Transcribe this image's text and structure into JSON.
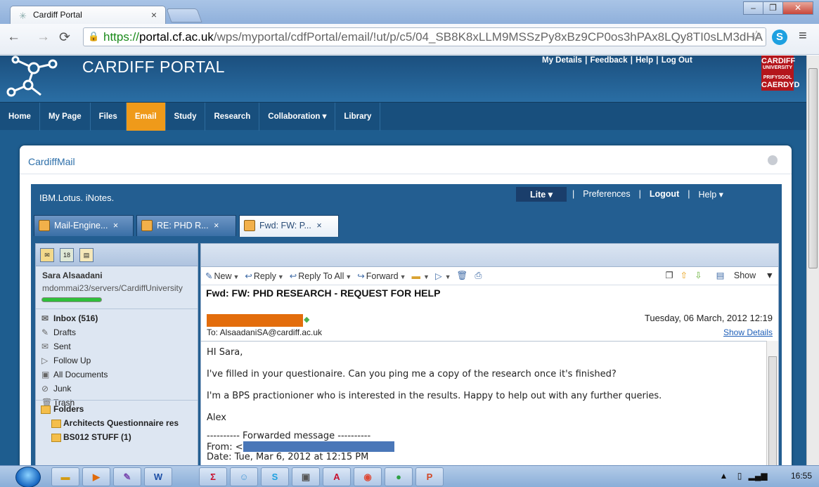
{
  "browser": {
    "tab_title": "Cardiff Portal",
    "tab_close": "×",
    "url_https": "https://",
    "url_domain": "portal.cf.ac.uk",
    "url_path": "/wps/myportal/cdfPortal/email/!ut/p/c5/04_SB8K8xLLM9MSSzPy8xBz9CP0os3hPAx8LQy8TI0sLM3dHA"
  },
  "portal": {
    "brand": "CARDIFF PORTAL",
    "top_links": [
      "My Details",
      "Feedback",
      "Help",
      "Log Out"
    ],
    "logo_lines": [
      "CARDIFF",
      "UNIVERSITY",
      "PRIFYSGOL",
      "CAERDYD"
    ],
    "nav": [
      {
        "label": "Home"
      },
      {
        "label": "My Page"
      },
      {
        "label": "Files"
      },
      {
        "label": "Email",
        "active": true
      },
      {
        "label": "Study"
      },
      {
        "label": "Research"
      },
      {
        "label": "Collaboration ▾"
      },
      {
        "label": "Library"
      }
    ],
    "card_title": "CardiffMail"
  },
  "inotes": {
    "product": "IBM.Lotus. iNotes.",
    "menu": {
      "lite": "Lite ▾",
      "preferences": "Preferences",
      "logout": "Logout",
      "help": "Help ▾"
    },
    "tabs": [
      {
        "label": "Mail-Engine...",
        "close": "×"
      },
      {
        "label": "RE: PHD R...",
        "close": "×"
      },
      {
        "label": "Fwd: FW: P...",
        "close": "×",
        "active": true
      }
    ],
    "user_name": "Sara Alsaadani",
    "server": "mdommai23/servers/CardiffUniversity",
    "mailboxes": [
      {
        "label": "Inbox (516)",
        "icon": "inbox-icon",
        "bold": true
      },
      {
        "label": "Drafts",
        "icon": "drafts-icon"
      },
      {
        "label": "Sent",
        "icon": "sent-icon"
      },
      {
        "label": "Follow Up",
        "icon": "flag-icon"
      },
      {
        "label": "All Documents",
        "icon": "all-documents-icon"
      },
      {
        "label": "Junk",
        "icon": "junk-icon"
      },
      {
        "label": "Trash",
        "icon": "trash-icon"
      }
    ],
    "folders_title": "Folders",
    "folders": [
      "Architects Questionnaire res",
      "BS012 STUFF (1)"
    ],
    "actions": [
      "New",
      "Reply",
      "Reply To All",
      "Forward"
    ],
    "show_label": "Show",
    "message": {
      "subject": "Fwd: FW: PHD RESEARCH - REQUEST FOR HELP",
      "date": "Tuesday, 06 March, 2012 12:19",
      "to": "To:  AlsaadaniSA@cardiff.ac.uk",
      "show_details": "Show Details",
      "greeting": "HI Sara,",
      "para1": "I've filled in your questionaire. Can you ping me a copy of the research once it's finished?",
      "para2": "I'm a BPS practionioner who is interested in the results. Happy to help out with any further queries.",
      "signoff": "Alex",
      "fwd_header": "---------- Forwarded message ----------",
      "from_label": "From: <",
      "date_line": "Date: Tue, Mar 6, 2012 at 12:15 PM"
    }
  },
  "taskbar": {
    "clock": "16:55"
  }
}
